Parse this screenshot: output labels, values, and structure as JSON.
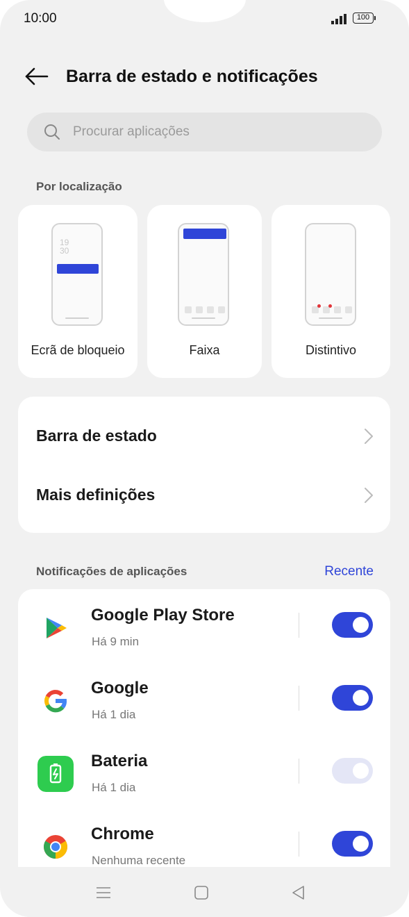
{
  "status_bar": {
    "time": "10:00",
    "battery": "100"
  },
  "header": {
    "title": "Barra de estado e notificações"
  },
  "search": {
    "placeholder": "Procurar aplicações"
  },
  "location": {
    "section_label": "Por localização",
    "options": [
      {
        "label": "Ecrã de bloqueio",
        "clock": "19\n30"
      },
      {
        "label": "Faixa"
      },
      {
        "label": "Distintivo"
      }
    ]
  },
  "settings": {
    "rows": [
      {
        "label": "Barra de estado"
      },
      {
        "label": "Mais definições"
      }
    ]
  },
  "apps": {
    "section_label": "Notificações de aplicações",
    "sort_label": "Recente",
    "items": [
      {
        "name": "Google Play Store",
        "sub": "Há 9 min",
        "enabled": true
      },
      {
        "name": "Google",
        "sub": "Há 1 dia",
        "enabled": true
      },
      {
        "name": "Bateria",
        "sub": "Há 1 dia",
        "enabled": true,
        "disabled": true
      },
      {
        "name": "Chrome",
        "sub": "Nenhuma recente",
        "enabled": true
      }
    ]
  },
  "colors": {
    "accent": "#2f45d8",
    "background": "#f1f1f1",
    "card": "#ffffff"
  }
}
